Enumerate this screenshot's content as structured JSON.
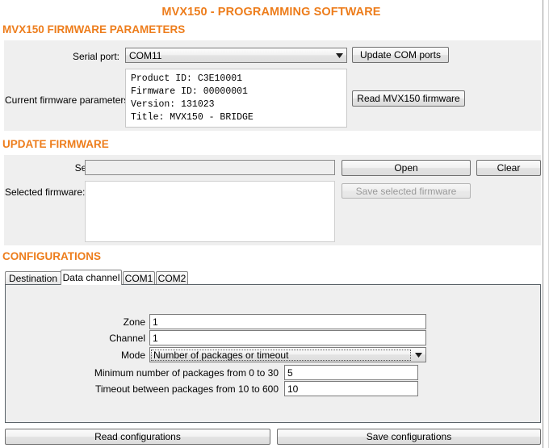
{
  "app": {
    "title": "MVX150 - PROGRAMMING SOFTWARE",
    "accent_color": "#ED7D1C",
    "panel_color": "#efefef"
  },
  "firmware_params": {
    "heading": "MVX150 FIRMWARE PARAMETERS",
    "serial_port_label": "Serial port:",
    "serial_port_value": "COM11",
    "serial_port_options": [
      "COM11"
    ],
    "update_com_ports_button": "Update COM ports",
    "current_params_label": "Current firmware parameters:",
    "current_params_text": "Product ID: C3E10001\nFirmware ID: 00000001\nVersion: 131023\nTitle: MVX150 - BRIDGE",
    "read_firmware_button": "Read MVX150 firmware"
  },
  "update_firmware": {
    "heading": "UPDATE FIRMWARE",
    "select_file_label": "Select file:",
    "select_file_value": "",
    "open_button": "Open",
    "clear_button": "Clear",
    "selected_firmware_label": "Selected firmware:",
    "selected_firmware_value": "",
    "save_selected_firmware_button": "Save selected firmware",
    "save_selected_firmware_enabled": false
  },
  "configurations": {
    "heading": "CONFIGURATIONS",
    "tabs": [
      {
        "label": "Destination",
        "active": false
      },
      {
        "label": "Data channel",
        "active": true
      },
      {
        "label": "COM1",
        "active": false
      },
      {
        "label": "COM2",
        "active": false
      }
    ],
    "fields": {
      "zone_label": "Zone",
      "zone_value": "1",
      "channel_label": "Channel",
      "channel_value": "1",
      "mode_label": "Mode",
      "mode_value": "Number of packages or timeout",
      "mode_options": [
        "Number of packages or timeout"
      ],
      "min_packages_label": "Minimum number of packages from 0 to 30",
      "min_packages_value": "5",
      "timeout_label": "Timeout between packages from 10 to 600",
      "timeout_value": "10"
    },
    "read_button": "Read configurations",
    "save_button": "Save configurations"
  }
}
